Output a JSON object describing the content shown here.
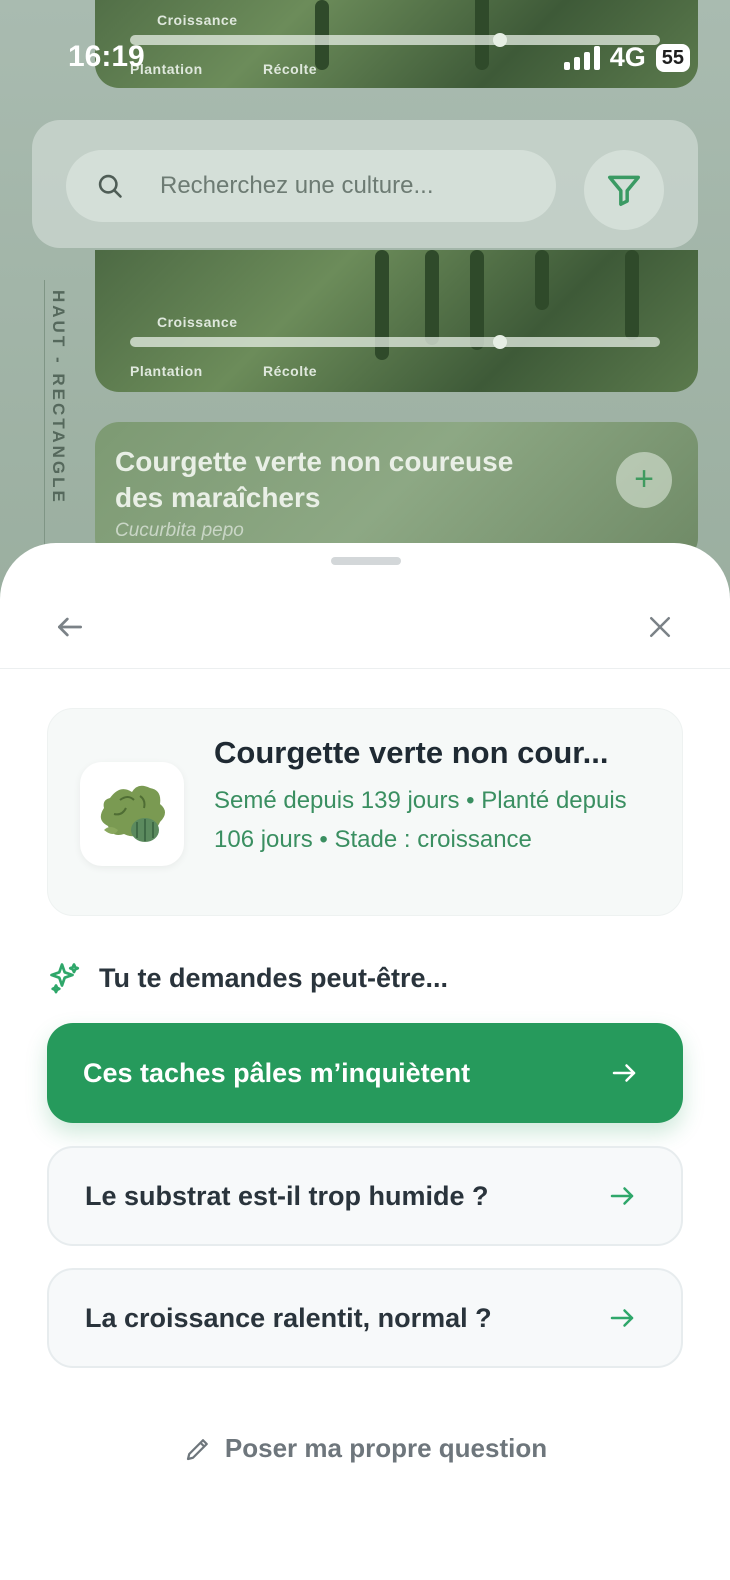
{
  "status_bar": {
    "time": "16:19",
    "network": "4G",
    "battery": "55"
  },
  "background": {
    "side_label": "HAUT - RECTANGLE",
    "timeline": {
      "growth_label": "Croissance",
      "planting_label": "Plantation",
      "harvest_label": "Récolte"
    },
    "crop_card": {
      "title": "Courgette verte non coureuse des maraîchers",
      "scientific_name": "Cucurbita pepo",
      "add_icon": "plus-icon"
    }
  },
  "search": {
    "placeholder": "Recherchez une culture...",
    "icon": "search-icon",
    "filter_icon": "filter-icon"
  },
  "sheet": {
    "back_icon": "arrow-left-icon",
    "close_icon": "close-icon",
    "plant": {
      "name": "Courgette verte non cour...",
      "meta": "Semé depuis 139 jours • Planté depuis 106 jours • Stade : croissance",
      "thumb_icon": "zucchini-plant-icon"
    },
    "suggestions_title": "Tu te demandes peut-être...",
    "suggestions_icon": "sparkles-icon",
    "suggestions": [
      {
        "label": "Ces taches pâles m’inquiètent",
        "style": "primary"
      },
      {
        "label": "Le substrat est-il trop humide ?",
        "style": "secondary"
      },
      {
        "label": "La croissance ralentit, normal ?",
        "style": "secondary"
      }
    ],
    "own_question": "Poser ma propre question",
    "own_question_icon": "pencil-icon"
  },
  "colors": {
    "accent_green": "#269a5c",
    "meta_green": "#3a8f61",
    "text_dark": "#2a343c",
    "muted": "#6e767c"
  }
}
